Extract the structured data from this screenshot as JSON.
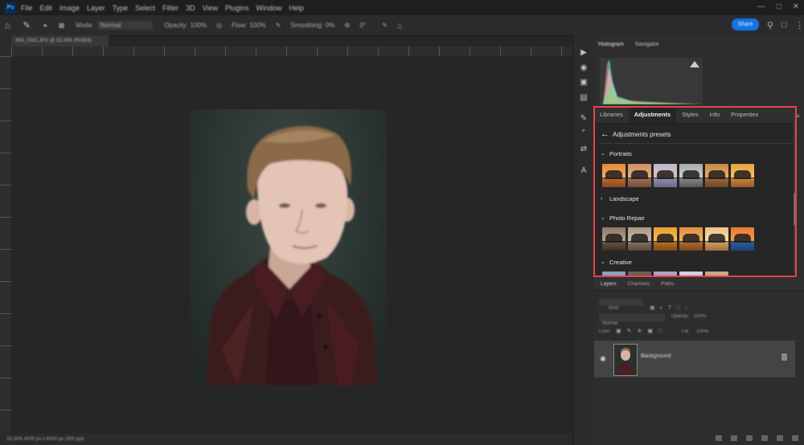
{
  "app": {
    "logo_text": "Ps"
  },
  "menu": [
    "File",
    "Edit",
    "Image",
    "Layer",
    "Type",
    "Select",
    "Filter",
    "3D",
    "View",
    "Plugins",
    "Window",
    "Help"
  ],
  "options_bar": {
    "mode_label": "Mode:",
    "mode_value": "Normal",
    "opacity_label": "Opacity:",
    "opacity_value": "100%",
    "flow_label": "Flow:",
    "flow_value": "100%",
    "smoothing_label": "Smoothing:",
    "smoothing_value": "0%",
    "angle_value": "0°",
    "share_label": "Share"
  },
  "document": {
    "tab_title": "IMG_0001.JPG @ 33.33% (RGB/8)",
    "status": "33.33%    4000 px x 6000 px (300 ppi)"
  },
  "histogram_panel": {
    "tabs": [
      "Histogram",
      "Navigator"
    ]
  },
  "adjustments_panel": {
    "tabs": [
      {
        "label": "Libraries",
        "active": false
      },
      {
        "label": "Adjustments",
        "active": true
      },
      {
        "label": "Styles",
        "active": false
      },
      {
        "label": "Info",
        "active": false
      },
      {
        "label": "Properties",
        "active": false
      }
    ],
    "back_label": "Adjustments presets",
    "sections": [
      {
        "label": "Portraits",
        "expanded": true
      },
      {
        "label": "Landscape",
        "expanded": false
      },
      {
        "label": "Photo Repair",
        "expanded": true
      },
      {
        "label": "Creative",
        "expanded": true
      }
    ],
    "accent_color": "#e8424c"
  },
  "layers_panel": {
    "tabs": [
      "Layers",
      "Channels",
      "Paths"
    ],
    "search_placeholder": "Kind",
    "blend_mode": "Normal",
    "opacity_label": "Opacity:",
    "opacity_value": "100%",
    "lock_label": "Lock:",
    "fill_label": "Fill:",
    "fill_value": "100%",
    "layer_name": "Background"
  }
}
